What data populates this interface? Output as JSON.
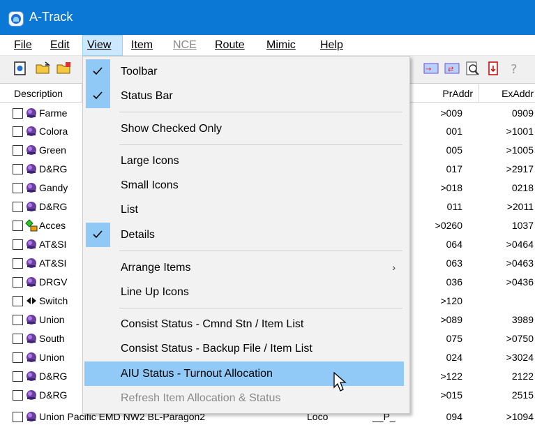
{
  "window": {
    "title": "A-Track"
  },
  "menu": {
    "file": "File",
    "edit": "Edit",
    "view": "View",
    "item": "Item",
    "nce": "NCE",
    "route": "Route",
    "mimic": "Mimic",
    "help": "Help"
  },
  "columns": {
    "description": "Description",
    "praddr": "PrAddr",
    "exaddr": "ExAddr"
  },
  "view_menu": [
    {
      "label": "Toolbar",
      "checked": true
    },
    {
      "label": "Status Bar",
      "checked": true
    },
    {
      "label": "Show Checked Only",
      "checked": false
    },
    {
      "label": "Large Icons",
      "checked": false
    },
    {
      "label": "Small Icons",
      "checked": false
    },
    {
      "label": "List",
      "checked": false
    },
    {
      "label": "Details",
      "checked": true
    },
    {
      "label": "Arrange Items",
      "submenu": true
    },
    {
      "label": "Line Up Icons"
    },
    {
      "label": "Consist Status - Cmnd Stn / Item List"
    },
    {
      "label": "Consist Status - Backup File / Item List"
    },
    {
      "label": "AIU Status - Turnout Allocation",
      "highlighted": true
    },
    {
      "label": "Refresh Item Allocation & Status",
      "disabled": true
    }
  ],
  "rows": [
    {
      "desc": "Farme",
      "pr": ">009",
      "ex": "0909",
      "icon": "locomotive-icon"
    },
    {
      "desc": "Colora",
      "pr": "001",
      "ex": ">1001",
      "icon": "locomotive-icon"
    },
    {
      "desc": "Green",
      "pr": "005",
      "ex": ">1005",
      "icon": "locomotive-icon"
    },
    {
      "desc": "D&RG",
      "pr": "017",
      "ex": ">2917",
      "icon": "locomotive-icon"
    },
    {
      "desc": "Gandy",
      "pr": ">018",
      "ex": "0218",
      "icon": "locomotive-icon"
    },
    {
      "desc": "D&RG",
      "pr": "011",
      "ex": ">2011",
      "icon": "locomotive-icon"
    },
    {
      "desc": "Acces",
      "pr": ">0260",
      "ex": "1037",
      "icon": "accessory-icon"
    },
    {
      "desc": "AT&SI",
      "pr": "064",
      "ex": ">0464",
      "icon": "locomotive-icon"
    },
    {
      "desc": "AT&SI",
      "pr": "063",
      "ex": ">0463",
      "icon": "locomotive-icon"
    },
    {
      "desc": "DRGV",
      "pr": "036",
      "ex": ">0436",
      "icon": "locomotive-icon"
    },
    {
      "desc": "Switch",
      "pr": ">120",
      "ex": "",
      "icon": "switch-icon"
    },
    {
      "desc": "Union",
      "pr": ">089",
      "ex": "3989",
      "icon": "locomotive-icon"
    },
    {
      "desc": "South",
      "pr": "075",
      "ex": ">0750",
      "icon": "locomotive-icon"
    },
    {
      "desc": "Union",
      "pr": "024",
      "ex": ">3024",
      "icon": "locomotive-icon"
    },
    {
      "desc": "D&RG",
      "pr": ">122",
      "ex": "2122",
      "icon": "locomotive-icon"
    },
    {
      "desc": "D&RG",
      "pr": ">015",
      "ex": "2515",
      "icon": "locomotive-icon"
    },
    {
      "desc": "Union Pacific EMD NW2 BL-Paragon2",
      "type": "Loco",
      "flags": "__P_",
      "pr": "094",
      "ex": ">1094",
      "icon": "locomotive-icon"
    }
  ],
  "colors": {
    "title_bar": "#0a78d4",
    "menu_highlight": "#91c9f7",
    "check_bg": "#90c8f6"
  }
}
